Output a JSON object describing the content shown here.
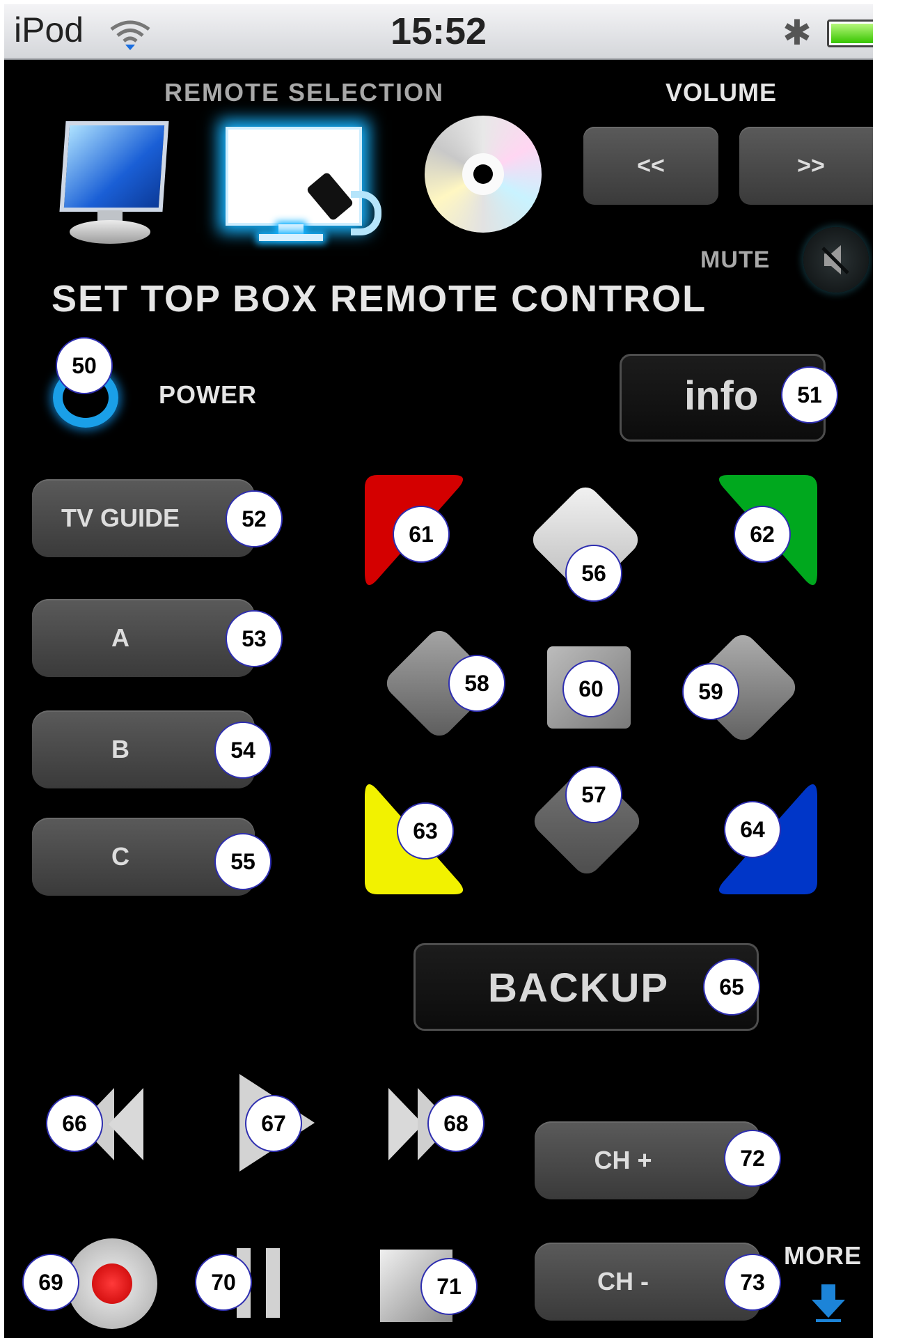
{
  "status_bar": {
    "carrier": "iPod",
    "time": "15:52"
  },
  "header": {
    "remote_selection_label": "REMOTE SELECTION",
    "volume_label": "VOLUME",
    "mute_label": "MUTE",
    "vol_down": "<<",
    "vol_up": ">>"
  },
  "title": "SET TOP BOX REMOTE CONTROL",
  "power_label": "POWER",
  "info_label": "info",
  "left_buttons": {
    "tv_guide": "TV GUIDE",
    "a": "A",
    "b": "B",
    "c": "C"
  },
  "backup_label": "BACKUP",
  "channel": {
    "up": "CH +",
    "down": "CH -"
  },
  "more_label": "MORE",
  "markers": {
    "m50": "50",
    "m51": "51",
    "m52": "52",
    "m53": "53",
    "m54": "54",
    "m55": "55",
    "m56": "56",
    "m57": "57",
    "m58": "58",
    "m59": "59",
    "m60": "60",
    "m61": "61",
    "m62": "62",
    "m63": "63",
    "m64": "64",
    "m65": "65",
    "m66": "66",
    "m67": "67",
    "m68": "68",
    "m69": "69",
    "m70": "70",
    "m71": "71",
    "m72": "72",
    "m73": "73"
  },
  "colors": {
    "red": "#d40000",
    "green": "#00a81e",
    "yellow": "#f2f200",
    "blue": "#0036c8",
    "accent_glow": "#18b4ff"
  }
}
